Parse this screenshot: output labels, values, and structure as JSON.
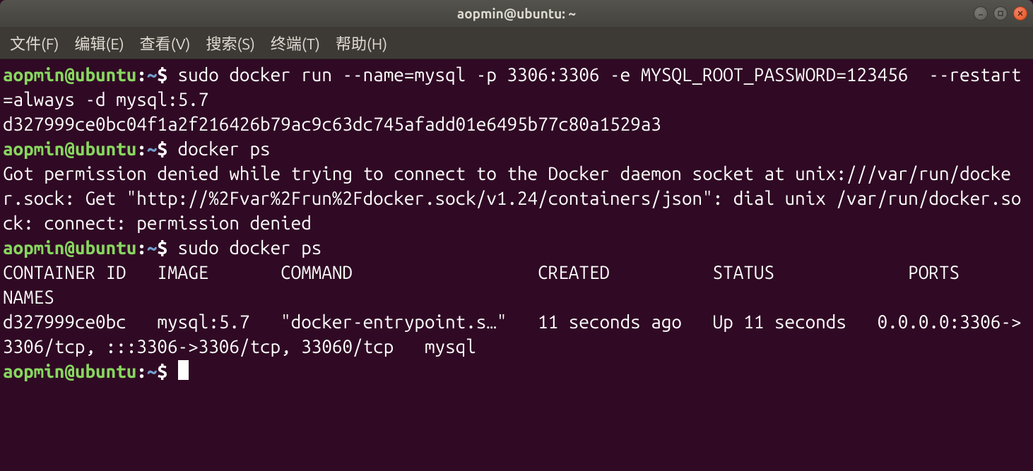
{
  "window": {
    "title": "aopmin@ubuntu: ~"
  },
  "menu": {
    "file": "文件(F)",
    "edit": "编辑(E)",
    "view": "查看(V)",
    "search": "搜索(S)",
    "terminal": "终端(T)",
    "help": "帮助(H)"
  },
  "prompt": {
    "user_host": "aopmin@ubuntu",
    "sep": ":",
    "path": "~",
    "dollar": "$"
  },
  "lines": {
    "cmd1": " sudo docker run --name=mysql -p 3306:3306 -e MYSQL_ROOT_PASSWORD=123456  --restart=always -d mysql:5.7",
    "out1": "d327999ce0bc04f1a2f216426b79ac9c63dc745afadd01e6495b77c80a1529a3",
    "cmd2": " docker ps",
    "out2": "Got permission denied while trying to connect to the Docker daemon socket at unix:///var/run/docker.sock: Get \"http://%2Fvar%2Frun%2Fdocker.sock/v1.24/containers/json\": dial unix /var/run/docker.sock: connect: permission denied",
    "cmd3": " sudo docker ps",
    "out3a": "CONTAINER ID   IMAGE       COMMAND                  CREATED          STATUS             PORTS                                                  NAMES",
    "out3b": "d327999ce0bc   mysql:5.7   \"docker-entrypoint.s…\"   11 seconds ago   Up 11 seconds   0.0.0.0:3306->3306/tcp, :::3306->3306/tcp, 33060/tcp   mysql",
    "cmd4": " "
  }
}
